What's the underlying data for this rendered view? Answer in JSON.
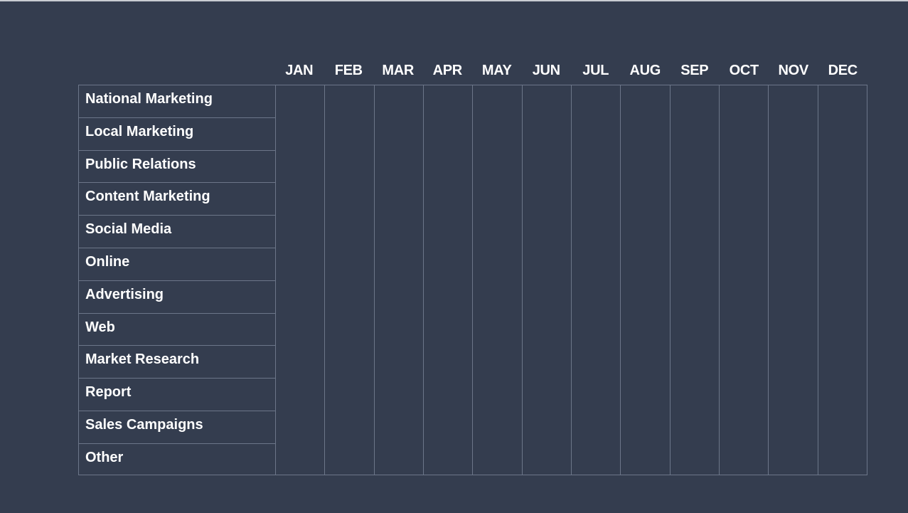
{
  "months": [
    "JAN",
    "FEB",
    "MAR",
    "APR",
    "MAY",
    "JUN",
    "JUL",
    "AUG",
    "SEP",
    "OCT",
    "NOV",
    "DEC"
  ],
  "categories": [
    "National Marketing",
    "Local Marketing",
    "Public Relations",
    "Content Marketing",
    "Social Media",
    "Online",
    "Advertising",
    "Web",
    "Market Research",
    "Report",
    "Sales Campaigns",
    "Other"
  ],
  "colors": {
    "background": "#343d4f",
    "grid_line": "#6c7689",
    "text": "#ffffff"
  }
}
